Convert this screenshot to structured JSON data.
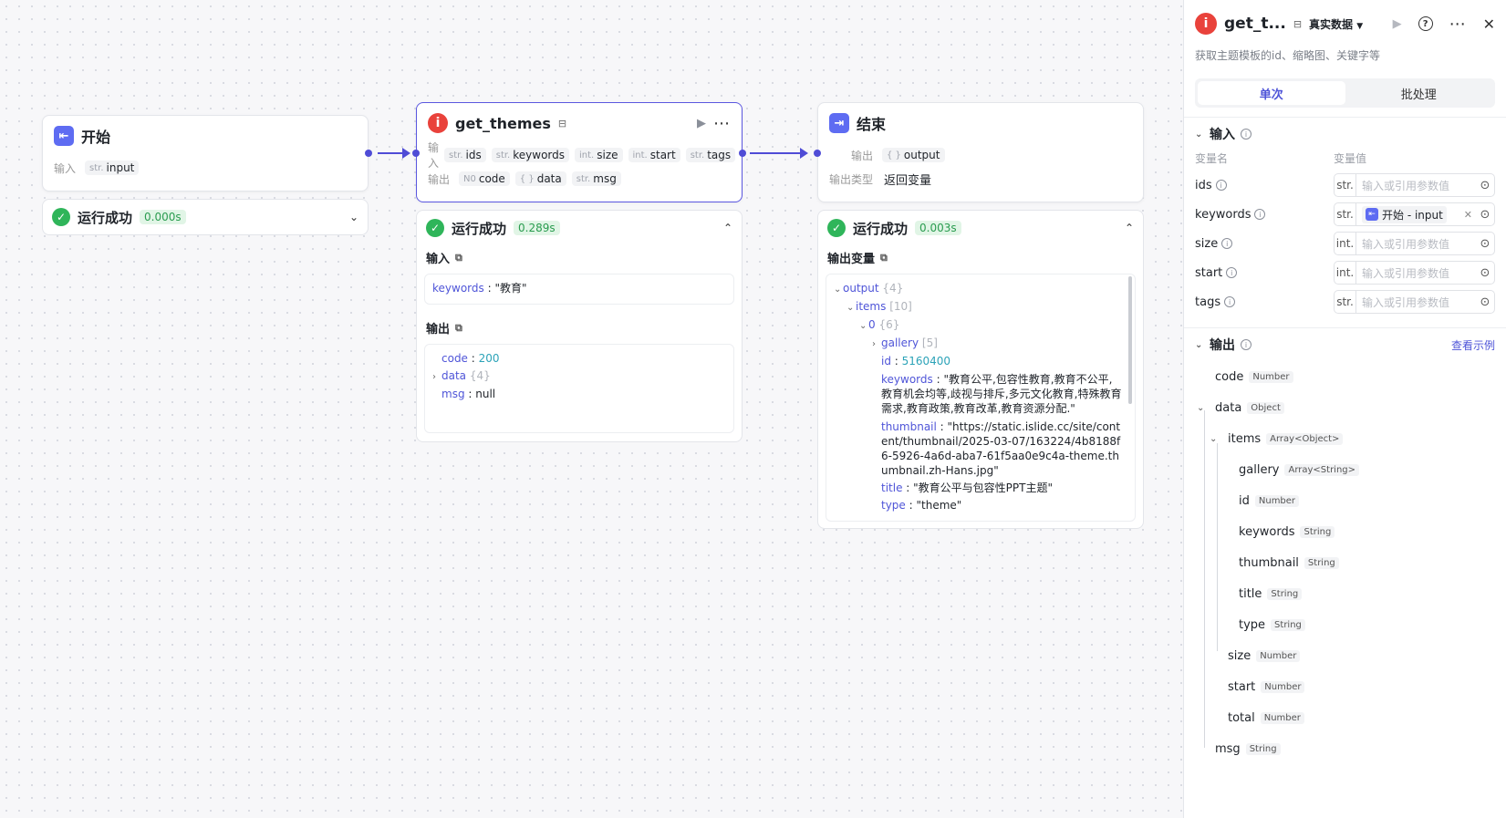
{
  "start_node": {
    "title": "开始",
    "input_label": "输入",
    "input_type": "str.",
    "input_name": "input",
    "result": {
      "status": "运行成功",
      "time": "0.000s"
    }
  },
  "get_themes_node": {
    "title": "get_themes",
    "input_label": "输入",
    "output_label": "输出",
    "inputs": [
      {
        "type": "str.",
        "name": "ids"
      },
      {
        "type": "str.",
        "name": "keywords"
      },
      {
        "type": "int.",
        "name": "size"
      },
      {
        "type": "int.",
        "name": "start"
      },
      {
        "type": "str.",
        "name": "tags"
      }
    ],
    "outputs": [
      {
        "type": "N0",
        "name": "code"
      },
      {
        "type": "{ }",
        "name": "data"
      },
      {
        "type": "str.",
        "name": "msg"
      }
    ],
    "result": {
      "status": "运行成功",
      "time": "0.289s",
      "input_title": "输入",
      "input_key": "keywords",
      "input_value": "\"教育\"",
      "output_title": "输出",
      "code_key": "code",
      "code_value": "200",
      "data_key": "data",
      "data_count": "{4}",
      "msg_key": "msg",
      "msg_value": "null"
    }
  },
  "end_node": {
    "title": "结束",
    "output_label": "输出",
    "output_type": "{ }",
    "output_name": "output",
    "output_type_label": "输出类型",
    "output_type_value": "返回变量",
    "result": {
      "status": "运行成功",
      "time": "0.003s",
      "vars_title": "输出变量",
      "output_key": "output",
      "output_count": "{4}",
      "items_key": "items",
      "items_count": "[10]",
      "zero_key": "0",
      "zero_count": "{6}",
      "gallery_key": "gallery",
      "gallery_count": "[5]",
      "id_key": "id",
      "id_value": "5160400",
      "keywords_key": "keywords",
      "keywords_value": "\"教育公平,包容性教育,教育不公平,教育机会均等,歧视与排斥,多元文化教育,特殊教育需求,教育政策,教育改革,教育资源分配.\"",
      "thumbnail_key": "thumbnail",
      "thumbnail_value": "\"https://static.islide.cc/site/content/thumbnail/2025-03-07/163224/4b8188f6-5926-4a6d-aba7-61f5aa0e9c4a-theme.thumbnail.zh-Hans.jpg\"",
      "title_key": "title",
      "title_value": "\"教育公平与包容性PPT主题\"",
      "type_key": "type",
      "type_value": "\"theme\""
    }
  },
  "panel": {
    "title": "get_t...",
    "data_mode": "真实数据",
    "subtitle": "获取主题模板的id、缩略图、关键字等",
    "tabs": [
      "单次",
      "批处理"
    ],
    "input_section": "输入",
    "col_name": "变量名",
    "col_value": "变量值",
    "placeholder": "输入或引用参数值",
    "fields": [
      {
        "name": "ids",
        "type": "str."
      },
      {
        "name": "keywords",
        "type": "str.",
        "ref": "开始 - input"
      },
      {
        "name": "size",
        "type": "int."
      },
      {
        "name": "start",
        "type": "int."
      },
      {
        "name": "tags",
        "type": "str."
      }
    ],
    "output_section": "输出",
    "view_example": "查看示例",
    "tree": [
      {
        "name": "code",
        "type": "Number"
      },
      {
        "name": "data",
        "type": "Object"
      },
      {
        "name": "items",
        "type": "Array<Object>"
      },
      {
        "name": "gallery",
        "type": "Array<String>"
      },
      {
        "name": "id",
        "type": "Number"
      },
      {
        "name": "keywords",
        "type": "String"
      },
      {
        "name": "thumbnail",
        "type": "String"
      },
      {
        "name": "title",
        "type": "String"
      },
      {
        "name": "type",
        "type": "String"
      },
      {
        "name": "size",
        "type": "Number"
      },
      {
        "name": "start",
        "type": "Number"
      },
      {
        "name": "total",
        "type": "Number"
      },
      {
        "name": "msg",
        "type": "String"
      }
    ]
  }
}
